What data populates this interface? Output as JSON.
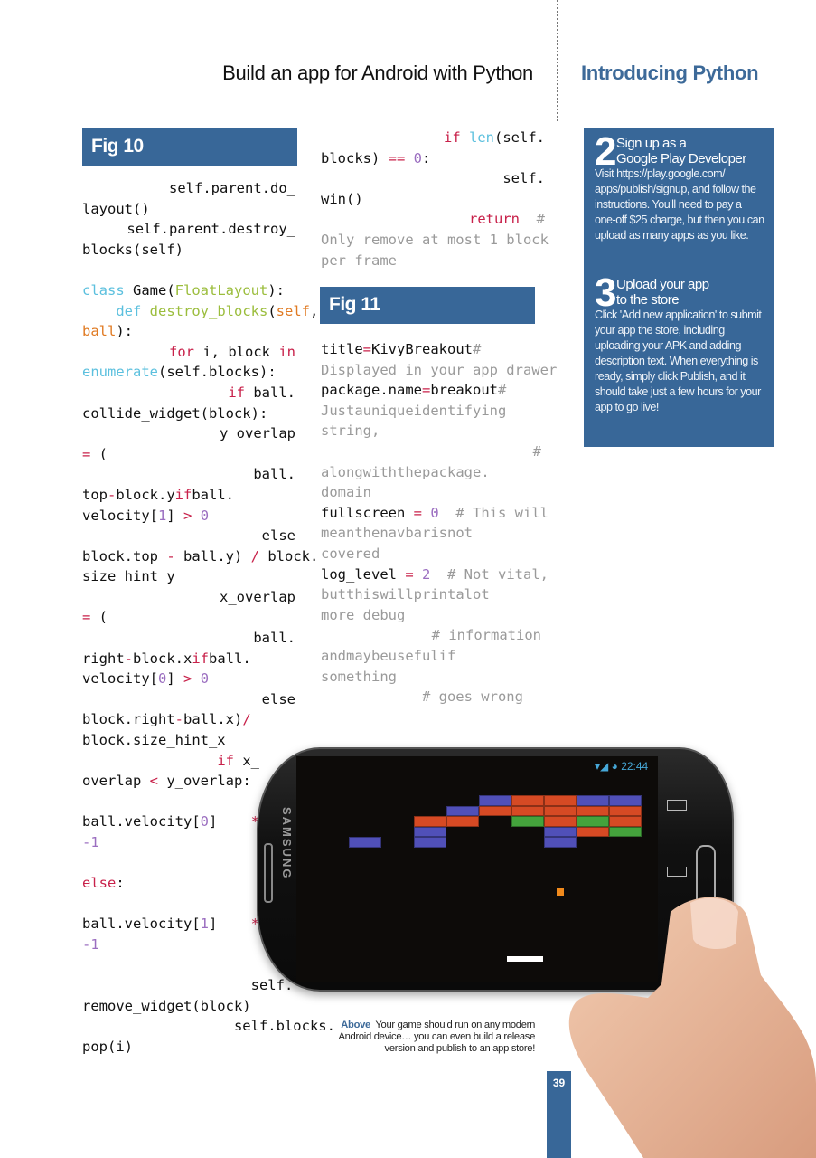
{
  "header": {
    "article_title": "Build an app for Android with Python",
    "section_title": "Introducing Python"
  },
  "fig10": {
    "label": "Fig 10",
    "lines": [
      {
        "align": "right",
        "parts": [
          {
            "t": "self.parent.do_"
          }
        ]
      },
      {
        "parts": [
          {
            "t": "layout()"
          }
        ]
      },
      {
        "align": "right",
        "parts": [
          {
            "t": "self.parent.destroy_"
          }
        ]
      },
      {
        "parts": [
          {
            "t": "blocks(self)"
          }
        ]
      },
      {
        "parts": [
          {
            "t": ""
          }
        ]
      },
      {
        "parts": [
          {
            "t": "class",
            "c": "bi"
          },
          {
            "t": " Game("
          },
          {
            "t": "FloatLayout",
            "c": "fn"
          },
          {
            "t": "):"
          }
        ]
      },
      {
        "parts": [
          {
            "t": "    "
          },
          {
            "t": "def",
            "c": "bi"
          },
          {
            "t": " "
          },
          {
            "t": "destroy_blocks",
            "c": "fn"
          },
          {
            "t": "("
          },
          {
            "t": "self",
            "c": "sf"
          },
          {
            "t": ","
          }
        ]
      },
      {
        "parts": [
          {
            "t": "ball",
            "c": "sf"
          },
          {
            "t": "):"
          }
        ]
      },
      {
        "align": "right",
        "parts": [
          {
            "t": "for",
            "c": "kw"
          },
          {
            "t": " i, block "
          },
          {
            "t": "in",
            "c": "kw"
          }
        ]
      },
      {
        "parts": [
          {
            "t": "enumerate",
            "c": "bi"
          },
          {
            "t": "(self.blocks):"
          }
        ]
      },
      {
        "align": "right",
        "parts": [
          {
            "t": "if",
            "c": "kw"
          },
          {
            "t": " ball."
          }
        ]
      },
      {
        "parts": [
          {
            "t": "collide_widget(block):"
          }
        ]
      },
      {
        "align": "right",
        "parts": [
          {
            "t": "y_overlap"
          }
        ]
      },
      {
        "parts": [
          {
            "t": "=",
            "c": "op"
          },
          {
            "t": " ("
          }
        ]
      },
      {
        "align": "right",
        "parts": [
          {
            "t": "ball."
          }
        ]
      },
      {
        "align": "justify",
        "parts": [
          {
            "t": "top"
          },
          {
            "t": "-",
            "c": "op"
          },
          {
            "t": "block.y"
          },
          {
            "t": "if",
            "c": "kw"
          },
          {
            "t": "ball."
          }
        ]
      },
      {
        "parts": [
          {
            "t": "velocity["
          },
          {
            "t": "1",
            "c": "nm"
          },
          {
            "t": "] "
          },
          {
            "t": ">",
            "c": "op"
          },
          {
            "t": " "
          },
          {
            "t": "0",
            "c": "nm"
          }
        ]
      },
      {
        "align": "right",
        "parts": [
          {
            "t": "else"
          }
        ]
      },
      {
        "parts": [
          {
            "t": "block.top "
          },
          {
            "t": "-",
            "c": "op"
          },
          {
            "t": " ball.y) "
          },
          {
            "t": "/",
            "c": "op"
          },
          {
            "t": " block."
          }
        ]
      },
      {
        "parts": [
          {
            "t": "size_hint_y"
          }
        ]
      },
      {
        "align": "right",
        "parts": [
          {
            "t": "x_overlap"
          }
        ]
      },
      {
        "parts": [
          {
            "t": "=",
            "c": "op"
          },
          {
            "t": " ("
          }
        ]
      },
      {
        "align": "right",
        "parts": [
          {
            "t": "ball."
          }
        ]
      },
      {
        "align": "justify",
        "parts": [
          {
            "t": "right"
          },
          {
            "t": "-",
            "c": "op"
          },
          {
            "t": "block.x"
          },
          {
            "t": "if",
            "c": "kw"
          },
          {
            "t": "ball."
          }
        ]
      },
      {
        "parts": [
          {
            "t": "velocity["
          },
          {
            "t": "0",
            "c": "nm"
          },
          {
            "t": "] "
          },
          {
            "t": ">",
            "c": "op"
          },
          {
            "t": " "
          },
          {
            "t": "0",
            "c": "nm"
          }
        ]
      },
      {
        "align": "right",
        "parts": [
          {
            "t": "else"
          }
        ]
      },
      {
        "align": "justify",
        "parts": [
          {
            "t": "block.right"
          },
          {
            "t": "-",
            "c": "op"
          },
          {
            "t": "ball.x)"
          },
          {
            "t": "/",
            "c": "op"
          }
        ]
      },
      {
        "parts": [
          {
            "t": "block.size_hint_x"
          }
        ]
      },
      {
        "parts": [
          {
            "t": "                "
          },
          {
            "t": "if",
            "c": "kw"
          },
          {
            "t": " x_"
          }
        ]
      },
      {
        "parts": [
          {
            "t": "overlap "
          },
          {
            "t": "<",
            "c": "op"
          },
          {
            "t": " y_overlap:"
          }
        ]
      },
      {
        "parts": [
          {
            "t": ""
          }
        ]
      },
      {
        "parts": [
          {
            "t": "ball.velocity["
          },
          {
            "t": "0",
            "c": "nm"
          },
          {
            "t": "]    "
          },
          {
            "t": "*=",
            "c": "op"
          }
        ]
      },
      {
        "parts": [
          {
            "t": "-1",
            "c": "nm"
          }
        ]
      },
      {
        "parts": [
          {
            "t": ""
          }
        ]
      },
      {
        "parts": [
          {
            "t": "else",
            "c": "kw"
          },
          {
            "t": ":"
          }
        ]
      },
      {
        "parts": [
          {
            "t": ""
          }
        ]
      },
      {
        "parts": [
          {
            "t": "ball.velocity["
          },
          {
            "t": "1",
            "c": "nm"
          },
          {
            "t": "]    "
          },
          {
            "t": "*=",
            "c": "op"
          }
        ]
      },
      {
        "parts": [
          {
            "t": "-1",
            "c": "nm"
          }
        ]
      },
      {
        "parts": [
          {
            "t": ""
          }
        ]
      },
      {
        "parts": [
          {
            "t": "                    self."
          }
        ]
      },
      {
        "parts": [
          {
            "t": "remove_widget(block)"
          }
        ]
      },
      {
        "parts": [
          {
            "t": "                  self.blocks."
          }
        ]
      },
      {
        "parts": [
          {
            "t": "pop(i)"
          }
        ]
      }
    ]
  },
  "fig10_continued": {
    "lines": [
      {
        "align": "right",
        "parts": [
          {
            "t": "if",
            "c": "kw"
          },
          {
            "t": " "
          },
          {
            "t": "len",
            "c": "bi"
          },
          {
            "t": "(self."
          }
        ]
      },
      {
        "parts": [
          {
            "t": "blocks) "
          },
          {
            "t": "==",
            "c": "op"
          },
          {
            "t": " "
          },
          {
            "t": "0",
            "c": "nm"
          },
          {
            "t": ":"
          }
        ]
      },
      {
        "align": "right",
        "parts": [
          {
            "t": "self."
          }
        ]
      },
      {
        "parts": [
          {
            "t": "win()"
          }
        ]
      },
      {
        "align": "right",
        "parts": [
          {
            "t": "return",
            "c": "kw"
          },
          {
            "t": "  "
          },
          {
            "t": "#",
            "c": "cm"
          }
        ]
      },
      {
        "parts": [
          {
            "t": "Only remove at most 1 block",
            "c": "cm"
          }
        ]
      },
      {
        "parts": [
          {
            "t": "per frame",
            "c": "cm"
          }
        ]
      }
    ]
  },
  "fig11": {
    "label": "Fig 11",
    "lines": [
      {
        "align": "justify",
        "parts": [
          {
            "t": "title"
          },
          {
            "t": "=",
            "c": "op"
          },
          {
            "t": "Kivy"
          },
          {
            "t": "Breakout"
          },
          {
            "t": "#",
            "c": "cm"
          }
        ]
      },
      {
        "parts": [
          {
            "t": "Displayed in your app drawer",
            "c": "cm"
          }
        ]
      },
      {
        "align": "justify",
        "parts": [
          {
            "t": "package.name"
          },
          {
            "t": "=",
            "c": "op"
          },
          {
            "t": "breakout"
          },
          {
            "t": "#",
            "c": "cm"
          }
        ]
      },
      {
        "align": "justify",
        "parts": [
          {
            "t": "Just",
            "c": "cm"
          },
          {
            "t": "a",
            "c": "cm"
          },
          {
            "t": "unique",
            "c": "cm"
          },
          {
            "t": "identifying",
            "c": "cm"
          }
        ]
      },
      {
        "parts": [
          {
            "t": "string,",
            "c": "cm"
          }
        ]
      },
      {
        "align": "right",
        "parts": [
          {
            "t": "#",
            "c": "cm"
          }
        ]
      },
      {
        "align": "justify",
        "parts": [
          {
            "t": "along",
            "c": "cm"
          },
          {
            "t": "with",
            "c": "cm"
          },
          {
            "t": "the",
            "c": "cm"
          },
          {
            "t": "package.",
            "c": "cm"
          }
        ]
      },
      {
        "parts": [
          {
            "t": "domain",
            "c": "cm"
          }
        ]
      },
      {
        "parts": [
          {
            "t": "fullscreen "
          },
          {
            "t": "=",
            "c": "op"
          },
          {
            "t": " "
          },
          {
            "t": "0",
            "c": "nm"
          },
          {
            "t": "  # This will",
            "c": "cm"
          }
        ]
      },
      {
        "align": "justify",
        "parts": [
          {
            "t": "mean",
            "c": "cm"
          },
          {
            "t": "the",
            "c": "cm"
          },
          {
            "t": "navbar",
            "c": "cm"
          },
          {
            "t": "is",
            "c": "cm"
          },
          {
            "t": "not",
            "c": "cm"
          }
        ]
      },
      {
        "parts": [
          {
            "t": "covered",
            "c": "cm"
          }
        ]
      },
      {
        "parts": [
          {
            "t": "log_level "
          },
          {
            "t": "=",
            "c": "op"
          },
          {
            "t": " "
          },
          {
            "t": "2",
            "c": "nm"
          },
          {
            "t": "  # Not vital,",
            "c": "cm"
          }
        ]
      },
      {
        "align": "justify",
        "parts": [
          {
            "t": "but",
            "c": "cm"
          },
          {
            "t": "this",
            "c": "cm"
          },
          {
            "t": "will",
            "c": "cm"
          },
          {
            "t": "print",
            "c": "cm"
          },
          {
            "t": "a",
            "c": "cm"
          },
          {
            "t": "lot",
            "c": "cm"
          }
        ]
      },
      {
        "parts": [
          {
            "t": "more debug",
            "c": "cm"
          }
        ]
      },
      {
        "align": "right",
        "parts": [
          {
            "t": "# information",
            "c": "cm"
          }
        ]
      },
      {
        "align": "justify",
        "parts": [
          {
            "t": "and",
            "c": "cm"
          },
          {
            "t": "may",
            "c": "cm"
          },
          {
            "t": "be",
            "c": "cm"
          },
          {
            "t": "useful",
            "c": "cm"
          },
          {
            "t": "if",
            "c": "cm"
          }
        ]
      },
      {
        "parts": [
          {
            "t": "something",
            "c": "cm"
          }
        ]
      },
      {
        "parts": [
          {
            "t": "            # goes wrong",
            "c": "cm"
          }
        ]
      }
    ]
  },
  "sidebar": {
    "steps": [
      {
        "number": "2",
        "heading_line1": "Sign up as a",
        "heading_line2": "Google Play Developer",
        "body": "Visit https://play.google.com/ apps/publish/signup, and follow the instructions. You'll need to pay a one-off $25 charge, but then you can upload as many apps as you like."
      },
      {
        "number": "3",
        "heading_line1": "Upload your app",
        "heading_line2": "to the store",
        "body": "Click 'Add new application' to submit your app the store, including uploading your APK and adding description text. When everything is ready, simply click Publish, and it should take just a few hours for your app to go live!"
      }
    ]
  },
  "phone": {
    "brand": "SAMSUNG",
    "status_time": "22:44",
    "icons": [
      "wifi-icon",
      "signal-icon",
      "sync-icon",
      "recent-apps-icon",
      "home-icon"
    ],
    "game": {
      "colors": {
        "blue": "#5050b8",
        "red": "#d64a24",
        "green": "#44a33c",
        "ball": "#f08a1c",
        "paddle": "#ffffff"
      },
      "blocks": [
        {
          "row": 0,
          "col": 4,
          "color": "blue"
        },
        {
          "row": 0,
          "col": 5,
          "color": "red"
        },
        {
          "row": 0,
          "col": 6,
          "color": "red"
        },
        {
          "row": 0,
          "col": 7,
          "color": "blue"
        },
        {
          "row": 0,
          "col": 8,
          "color": "blue"
        },
        {
          "row": 1,
          "col": 3,
          "color": "blue"
        },
        {
          "row": 1,
          "col": 4,
          "color": "red"
        },
        {
          "row": 1,
          "col": 5,
          "color": "red"
        },
        {
          "row": 1,
          "col": 6,
          "color": "red"
        },
        {
          "row": 1,
          "col": 7,
          "color": "red"
        },
        {
          "row": 1,
          "col": 8,
          "color": "red"
        },
        {
          "row": 2,
          "col": 2,
          "color": "red"
        },
        {
          "row": 2,
          "col": 3,
          "color": "red"
        },
        {
          "row": 2,
          "col": 5,
          "color": "green"
        },
        {
          "row": 2,
          "col": 6,
          "color": "red"
        },
        {
          "row": 2,
          "col": 7,
          "color": "green"
        },
        {
          "row": 2,
          "col": 8,
          "color": "red"
        },
        {
          "row": 3,
          "col": 2,
          "color": "blue"
        },
        {
          "row": 3,
          "col": 6,
          "color": "blue"
        },
        {
          "row": 3,
          "col": 7,
          "color": "red"
        },
        {
          "row": 3,
          "col": 8,
          "color": "green"
        },
        {
          "row": 4,
          "col": 0,
          "color": "blue"
        },
        {
          "row": 4,
          "col": 2,
          "color": "blue"
        },
        {
          "row": 4,
          "col": 6,
          "color": "blue"
        }
      ]
    }
  },
  "caption": {
    "label": "Above",
    "text": "Your game should run on any modern Android device… you can even build a release version and publish to an app store!"
  },
  "page_number": "39",
  "colors": {
    "accent": "#386798"
  }
}
